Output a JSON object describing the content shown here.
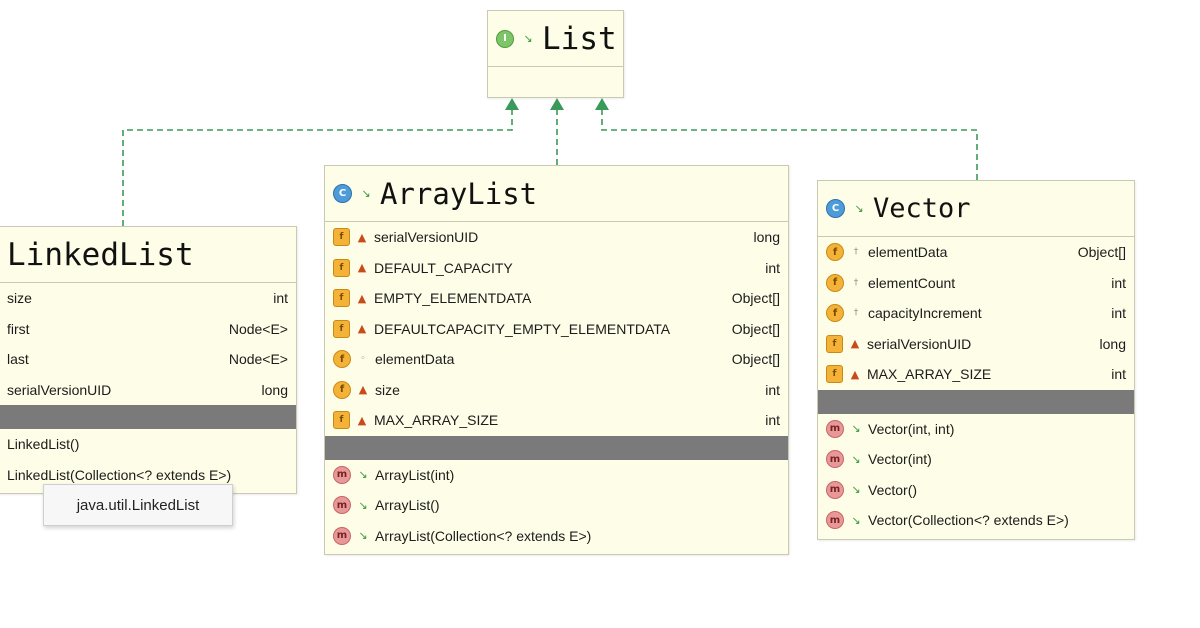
{
  "diagram": {
    "interface": {
      "name": "List",
      "badge": "I"
    },
    "classes": [
      {
        "id": "linkedlist",
        "name": "LinkedList",
        "fields": [
          {
            "name": "size",
            "type": "int",
            "kind": "field",
            "visibility": "package"
          },
          {
            "name": "first",
            "type": "Node<E>",
            "kind": "field",
            "visibility": "package"
          },
          {
            "name": "last",
            "type": "Node<E>",
            "kind": "field",
            "visibility": "package"
          },
          {
            "name": "serialVersionUID",
            "type": "long",
            "kind": "static-final",
            "visibility": "private"
          }
        ],
        "methods": [
          {
            "name": "LinkedList()",
            "visibility": "public"
          },
          {
            "name": "LinkedList(Collection<? extends E>)",
            "visibility": "public"
          }
        ],
        "tooltip": "java.util.LinkedList"
      },
      {
        "id": "arraylist",
        "name": "ArrayList",
        "badge": "C",
        "fields": [
          {
            "name": "serialVersionUID",
            "type": "long",
            "kind": "static-final",
            "visibility": "private"
          },
          {
            "name": "DEFAULT_CAPACITY",
            "type": "int",
            "kind": "static-final",
            "visibility": "private"
          },
          {
            "name": "EMPTY_ELEMENTDATA",
            "type": "Object[]",
            "kind": "static-final",
            "visibility": "private"
          },
          {
            "name": "DEFAULTCAPACITY_EMPTY_ELEMENTDATA",
            "type": "Object[]",
            "kind": "static-final",
            "visibility": "private"
          },
          {
            "name": "elementData",
            "type": "Object[]",
            "kind": "field",
            "visibility": "package"
          },
          {
            "name": "size",
            "type": "int",
            "kind": "field",
            "visibility": "private"
          },
          {
            "name": "MAX_ARRAY_SIZE",
            "type": "int",
            "kind": "static-final",
            "visibility": "private"
          }
        ],
        "methods": [
          {
            "name": "ArrayList(int)",
            "visibility": "public"
          },
          {
            "name": "ArrayList()",
            "visibility": "public"
          },
          {
            "name": "ArrayList(Collection<? extends E>)",
            "visibility": "public"
          }
        ]
      },
      {
        "id": "vector",
        "name": "Vector",
        "badge": "C",
        "fields": [
          {
            "name": "elementData",
            "type": "Object[]",
            "kind": "field",
            "visibility": "protected"
          },
          {
            "name": "elementCount",
            "type": "int",
            "kind": "field",
            "visibility": "protected"
          },
          {
            "name": "capacityIncrement",
            "type": "int",
            "kind": "field",
            "visibility": "protected"
          },
          {
            "name": "serialVersionUID",
            "type": "long",
            "kind": "static-final",
            "visibility": "private"
          },
          {
            "name": "MAX_ARRAY_SIZE",
            "type": "int",
            "kind": "static-final",
            "visibility": "private"
          }
        ],
        "methods": [
          {
            "name": "Vector(int, int)",
            "visibility": "public"
          },
          {
            "name": "Vector(int)",
            "visibility": "public"
          },
          {
            "name": "Vector()",
            "visibility": "public"
          },
          {
            "name": "Vector(Collection<? extends E>)",
            "visibility": "public"
          }
        ]
      }
    ],
    "relations": [
      {
        "from": "linkedlist",
        "to": "List",
        "kind": "implements",
        "line": "dashed",
        "color": "#3a9a5a"
      },
      {
        "from": "arraylist",
        "to": "List",
        "kind": "implements",
        "line": "dashed",
        "color": "#3a9a5a"
      },
      {
        "from": "vector",
        "to": "List",
        "kind": "implements",
        "line": "dashed",
        "color": "#3a9a5a"
      }
    ],
    "colors": {
      "node_fill": "#fdfde8",
      "node_border": "#c9c9b4",
      "section_divider": "#7a7a7a",
      "edge": "#3a9a5a",
      "field_badge": "#f4b338",
      "method_badge": "#e79898",
      "class_badge": "#4d9bd8",
      "interface_badge": "#7ec468"
    }
  }
}
